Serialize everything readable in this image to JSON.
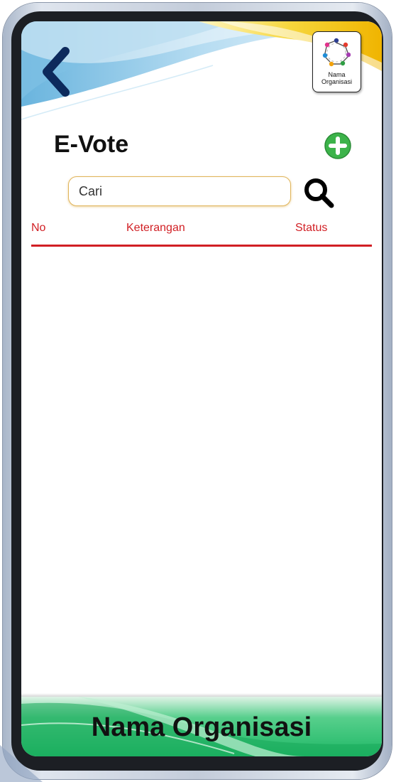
{
  "header": {
    "back_icon": "chevron-left-icon",
    "org_logo": {
      "icon": "people-circle-icon",
      "line1": "Nama",
      "line2": "Organisasi"
    }
  },
  "page": {
    "title": "E-Vote",
    "add_icon": "plus-circle-icon"
  },
  "search": {
    "placeholder": "Cari",
    "value": "",
    "icon": "search-icon"
  },
  "table": {
    "columns": {
      "no": "No",
      "keterangan": "Keterangan",
      "status": "Status"
    },
    "rows": []
  },
  "footer": {
    "title": "Nama Organisasi"
  },
  "colors": {
    "accent_red": "#d11f24",
    "add_green": "#3cb34a",
    "footer_green": "#1fb866",
    "search_border": "#e0b45a"
  }
}
